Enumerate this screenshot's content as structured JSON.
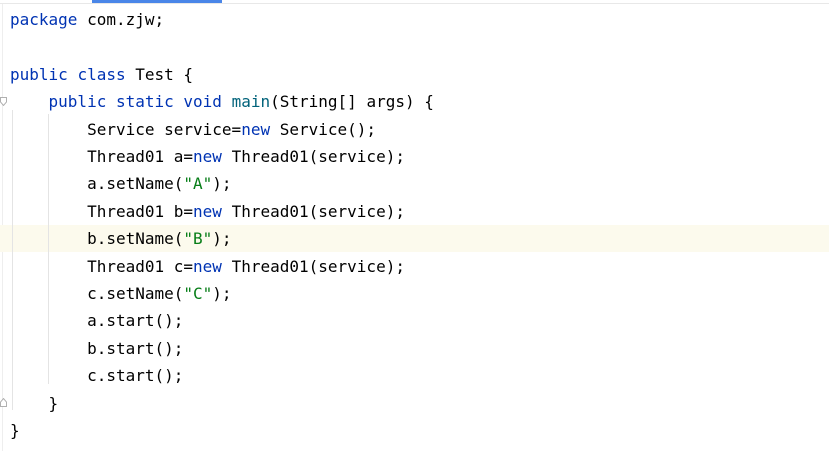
{
  "editor": {
    "language": "java",
    "colors": {
      "keyword": "#0033b3",
      "method_declaration": "#00627a",
      "string": "#067d17",
      "plain": "#080808",
      "current_line": "#fcfaed",
      "tab_indicator": "#4a86e8"
    },
    "current_line_index": 9,
    "lines": [
      [
        {
          "t": "package",
          "c": "kw"
        },
        {
          "t": " com.zjw;",
          "c": "id"
        }
      ],
      [],
      [
        {
          "t": "public",
          "c": "kw"
        },
        {
          "t": " ",
          "c": "id"
        },
        {
          "t": "class",
          "c": "kw"
        },
        {
          "t": " Test {",
          "c": "id"
        }
      ],
      [
        {
          "t": "    ",
          "c": "id"
        },
        {
          "t": "public",
          "c": "kw"
        },
        {
          "t": " ",
          "c": "id"
        },
        {
          "t": "static",
          "c": "kw"
        },
        {
          "t": " ",
          "c": "id"
        },
        {
          "t": "void",
          "c": "kw"
        },
        {
          "t": " ",
          "c": "id"
        },
        {
          "t": "main",
          "c": "fn"
        },
        {
          "t": "(String[] args) {",
          "c": "id"
        }
      ],
      [
        {
          "t": "        Service service=",
          "c": "id"
        },
        {
          "t": "new",
          "c": "kw"
        },
        {
          "t": " Service();",
          "c": "id"
        }
      ],
      [
        {
          "t": "        Thread01 a=",
          "c": "id"
        },
        {
          "t": "new",
          "c": "kw"
        },
        {
          "t": " Thread01(service);",
          "c": "id"
        }
      ],
      [
        {
          "t": "        a.setName(",
          "c": "id"
        },
        {
          "t": "\"A\"",
          "c": "str"
        },
        {
          "t": ");",
          "c": "id"
        }
      ],
      [
        {
          "t": "        Thread01 b=",
          "c": "id"
        },
        {
          "t": "new",
          "c": "kw"
        },
        {
          "t": " Thread01(service);",
          "c": "id"
        }
      ],
      [
        {
          "t": "        b.setName(",
          "c": "id"
        },
        {
          "t": "\"B\"",
          "c": "str"
        },
        {
          "t": ");",
          "c": "id"
        }
      ],
      [
        {
          "t": "        Thread01 c=",
          "c": "id"
        },
        {
          "t": "new",
          "c": "kw"
        },
        {
          "t": " Thread01(service);",
          "c": "id"
        }
      ],
      [
        {
          "t": "        c.setName(",
          "c": "id"
        },
        {
          "t": "\"C\"",
          "c": "str"
        },
        {
          "t": ");",
          "c": "id"
        }
      ],
      [
        {
          "t": "        a.start();",
          "c": "id"
        }
      ],
      [
        {
          "t": "        b.start();",
          "c": "id"
        }
      ],
      [
        {
          "t": "        c.start();",
          "c": "id"
        }
      ],
      [
        {
          "t": "    }",
          "c": "id"
        }
      ],
      [
        {
          "t": "}",
          "c": "id"
        }
      ]
    ]
  }
}
